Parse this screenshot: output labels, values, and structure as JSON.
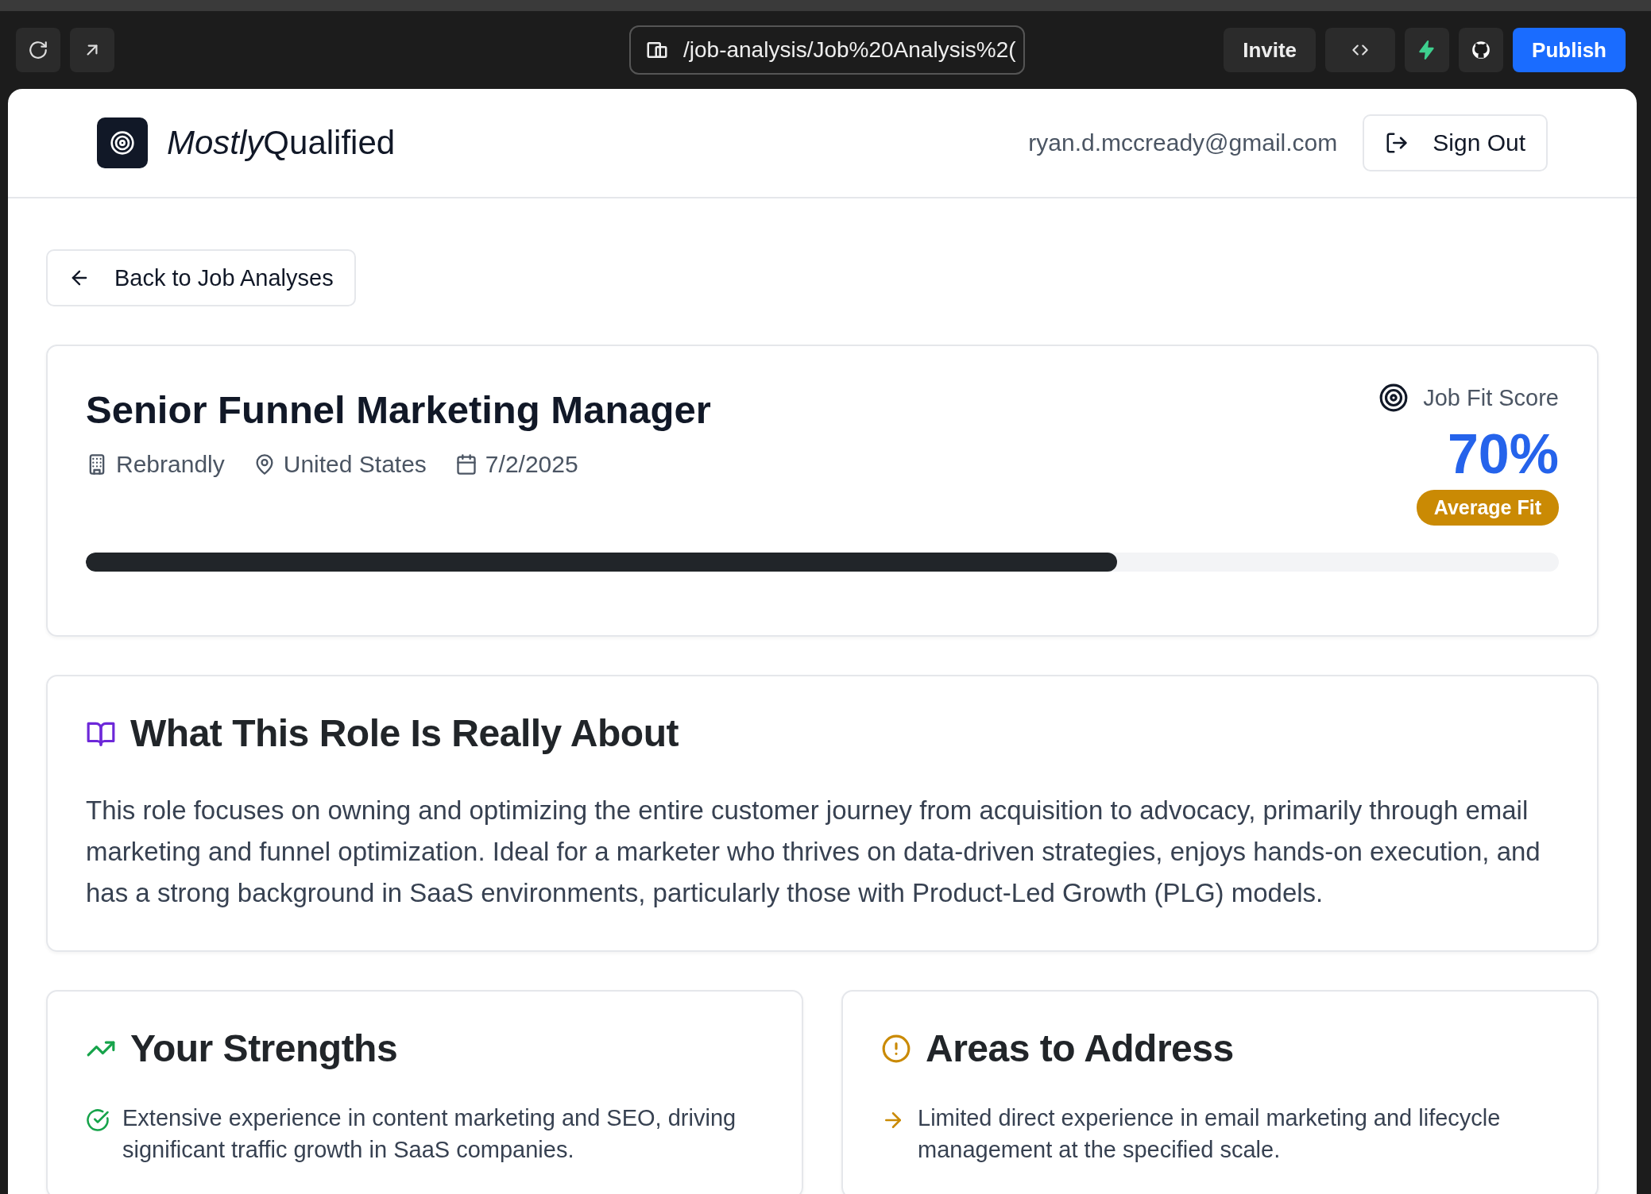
{
  "browser_bar": {
    "url": "/job-analysis/Job%20Analysis%2(",
    "invite": "Invite",
    "publish": "Publish"
  },
  "header": {
    "brand_italic": "Mostly",
    "brand_rest": "Qualified",
    "email": "ryan.d.mccready@gmail.com",
    "sign_out": "Sign Out"
  },
  "back_button": "Back to Job Analyses",
  "job": {
    "title": "Senior Funnel Marketing Manager",
    "company": "Rebrandly",
    "location": "United States",
    "date": "7/2/2025",
    "score_label": "Job Fit Score",
    "score": "70%",
    "fit_badge": "Average Fit",
    "level": 0.7
  },
  "about": {
    "heading": "What This Role Is Really About",
    "text": "This role focuses on owning and optimizing the entire customer journey from acquisition to advocacy, primarily through email marketing and funnel optimization. Ideal for a marketer who thrives on data-driven strategies, enjoys hands-on execution, and has a strong background in SaaS environments, particularly those with Product-Led Growth (PLG) models."
  },
  "panels": [
    {
      "kind": "strengths",
      "heading": "Your Strengths",
      "items": [
        "Extensive experience in content marketing and SEO, driving significant traffic growth in SaaS companies."
      ]
    },
    {
      "kind": "gaps",
      "heading": "Areas to Address",
      "items": [
        "Limited direct experience in email marketing and lifecycle management at the specified scale."
      ]
    }
  ]
}
